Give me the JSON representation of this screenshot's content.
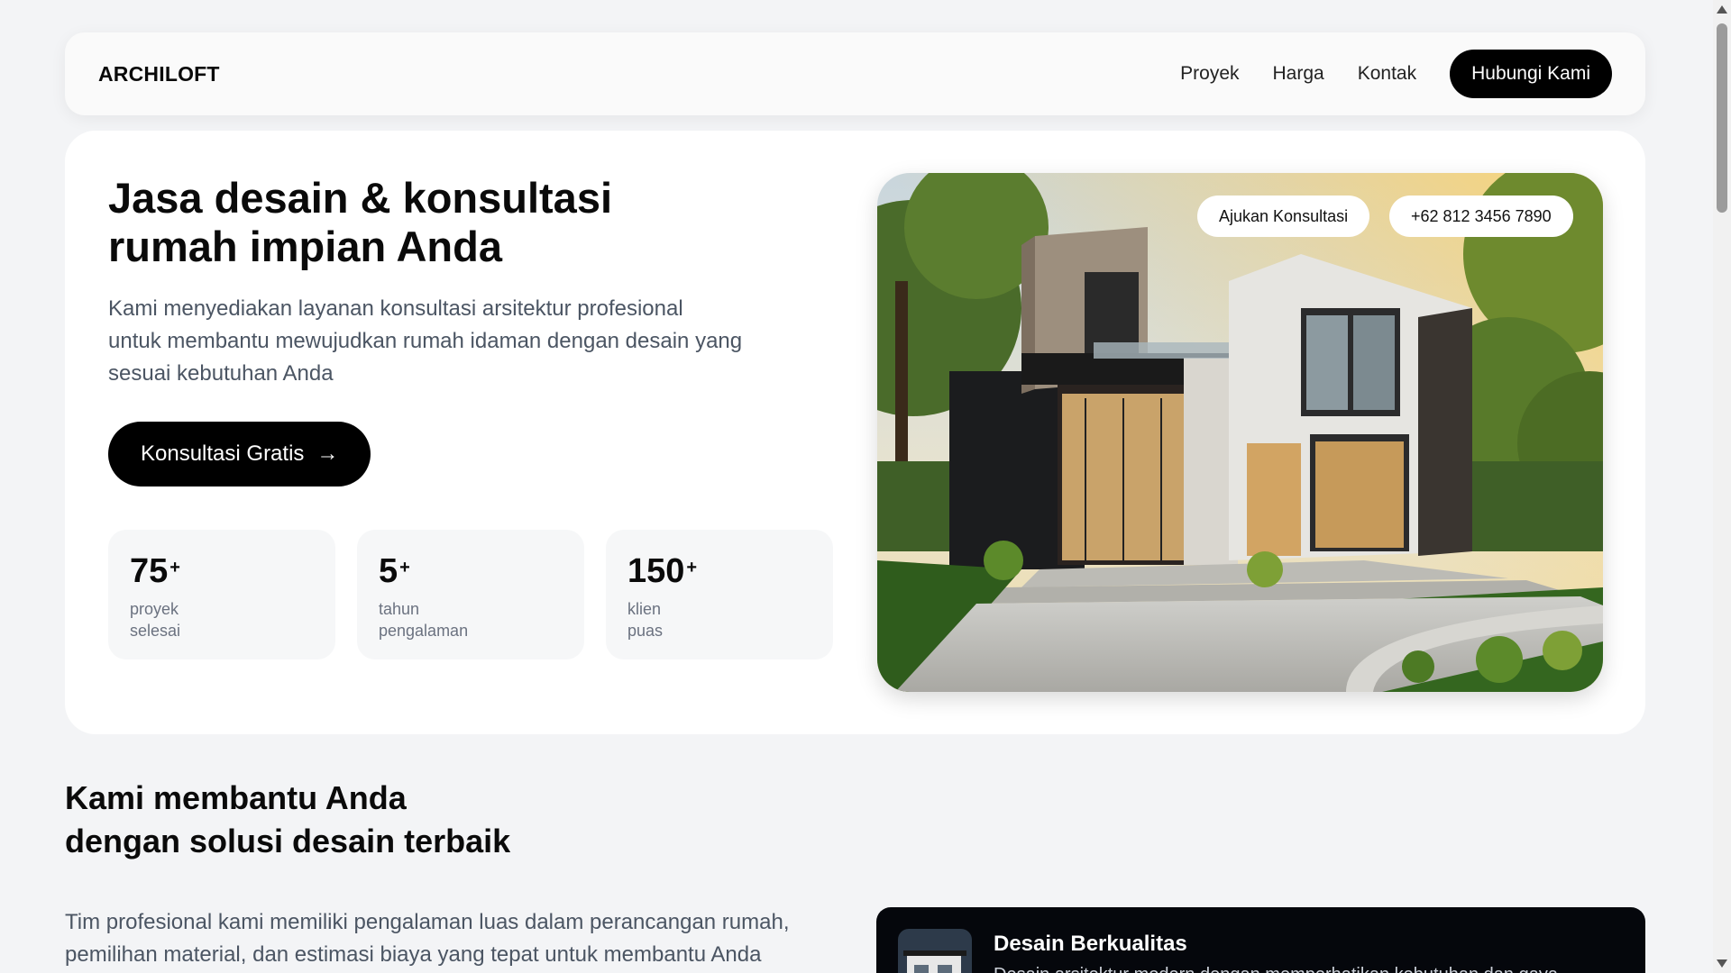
{
  "navbar": {
    "brand": "ARCHILOFT",
    "links": [
      "Proyek",
      "Harga",
      "Kontak"
    ],
    "cta": "Hubungi Kami"
  },
  "hero": {
    "title_line1": "Jasa desain & konsultasi",
    "title_line2": "rumah impian Anda",
    "desc_line1": "Kami menyediakan layanan konsultasi arsitektur profesional",
    "desc_line2": "untuk membantu mewujudkan rumah idaman dengan desain yang",
    "desc_line3": "sesuai kebutuhan Anda",
    "button": "Konsultasi Gratis",
    "image_pill_primary": "Ajukan Konsultasi",
    "image_pill_phone": "+62 812 3456 7890",
    "stats": [
      {
        "value": "75",
        "suffix": "+",
        "label_line1": "proyek",
        "label_line2": "selesai"
      },
      {
        "value": "5",
        "suffix": "+",
        "label_line1": "tahun",
        "label_line2": "pengalaman"
      },
      {
        "value": "150",
        "suffix": "+",
        "label_line1": "klien",
        "label_line2": "puas"
      }
    ]
  },
  "section": {
    "title_line1": "Kami membantu Anda",
    "title_line2": "dengan solusi desain terbaik",
    "desc_line1": "Tim profesional kami memiliki pengalaman luas dalam perancangan rumah,",
    "desc_line2": "pemilihan material, dan estimasi biaya yang tepat untuk membantu Anda",
    "feature": {
      "title": "Desain Berkualitas",
      "desc": "Desain arsitektur modern dengan memperhatikan kebutuhan dan gaya"
    }
  },
  "colors": {
    "background": "#f3f4f6",
    "card": "#ffffff",
    "accent": "#000000",
    "muted_text": "#4b5563",
    "feature_card": "#05070c"
  },
  "icons": [
    "arrow-right-icon",
    "house-photo"
  ]
}
